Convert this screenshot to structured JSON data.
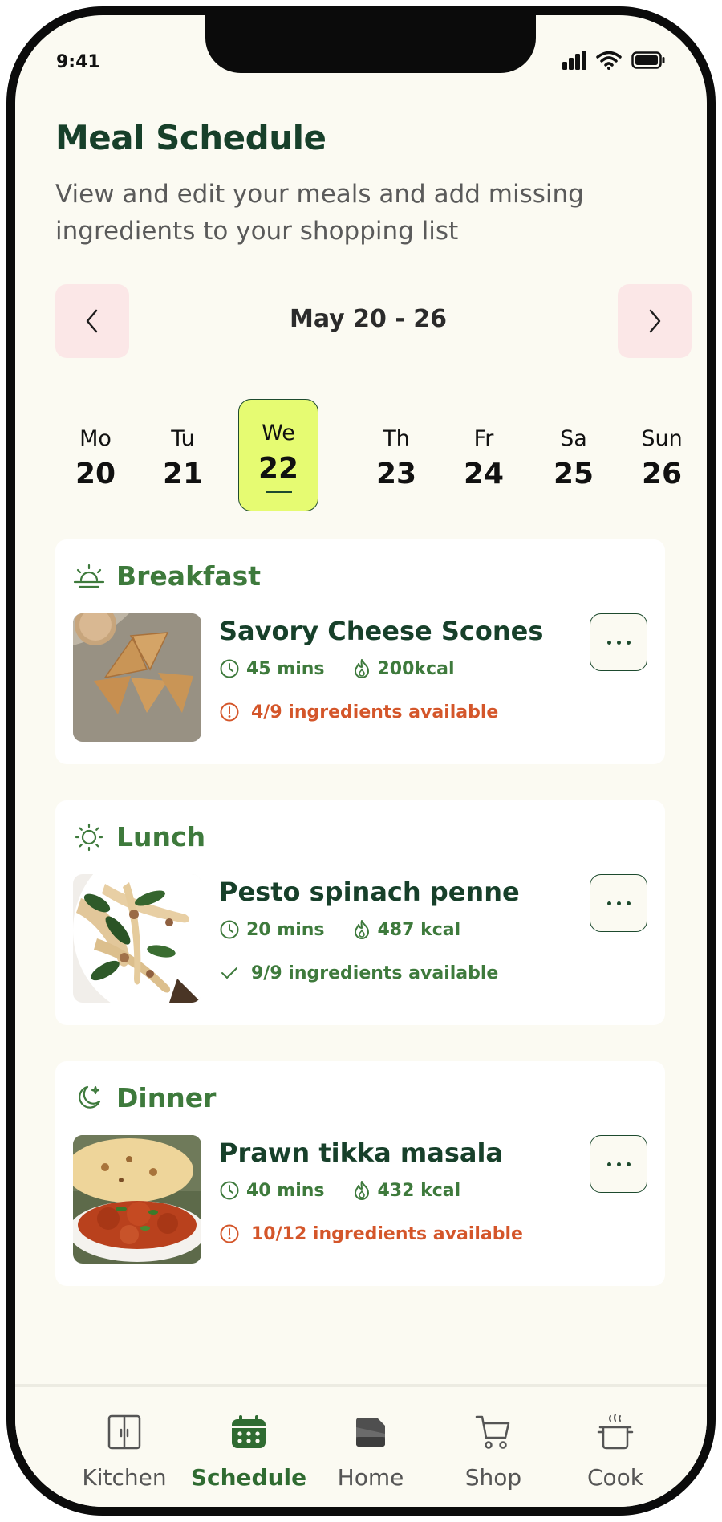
{
  "status": {
    "time": "9:41"
  },
  "header": {
    "title": "Meal Schedule",
    "subtitle": "View and edit your meals and add missing ingredients to your shopping list"
  },
  "week": {
    "label": "May 20 - 26"
  },
  "days": [
    {
      "name": "Mo",
      "date": "20"
    },
    {
      "name": "Tu",
      "date": "21"
    },
    {
      "name": "We",
      "date": "22",
      "selected": true
    },
    {
      "name": "Th",
      "date": "23"
    },
    {
      "name": "Fr",
      "date": "24"
    },
    {
      "name": "Sa",
      "date": "25"
    },
    {
      "name": "Sun",
      "date": "26"
    }
  ],
  "meals": [
    {
      "type": "Breakfast",
      "icon": "sunrise-icon",
      "recipe": "Savory Cheese Scones",
      "time": "45 mins",
      "calories": "200kcal",
      "availability": "4/9 ingredients available",
      "status": "missing"
    },
    {
      "type": "Lunch",
      "icon": "sun-icon",
      "recipe": "Pesto spinach penne",
      "time": "20 mins",
      "calories": "487 kcal",
      "availability": "9/9 ingredients available",
      "status": "complete"
    },
    {
      "type": "Dinner",
      "icon": "moon-stars-icon",
      "recipe": "Prawn tikka masala",
      "time": "40 mins",
      "calories": "432 kcal",
      "availability": "10/12 ingredients available",
      "status": "missing"
    }
  ],
  "tabs": [
    {
      "label": "Kitchen",
      "icon": "cabinet-icon"
    },
    {
      "label": "Schedule",
      "icon": "calendar-icon",
      "active": true
    },
    {
      "label": "Home",
      "icon": "home-icon"
    },
    {
      "label": "Shop",
      "icon": "cart-icon"
    },
    {
      "label": "Cook",
      "icon": "pot-icon"
    }
  ],
  "colors": {
    "background": "#fbfaf2",
    "primary": "#17402a",
    "accent_green": "#3e7a3c",
    "highlight": "#e6fb72",
    "warning": "#d4562a",
    "nav_button": "#fbe7e7"
  }
}
